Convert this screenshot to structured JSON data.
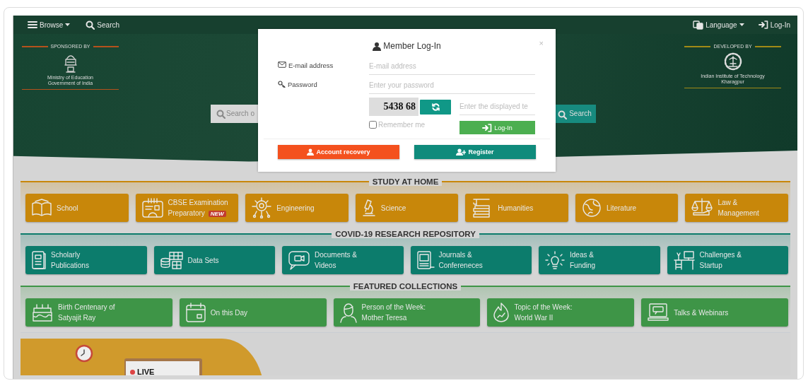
{
  "nav": {
    "browse": "Browse",
    "search": "Search",
    "language": "Language",
    "login": "Log-In"
  },
  "hero": {
    "sponsor": {
      "caption": "SPONSORED BY",
      "lines": "Ministry of Education\nGovernment of India"
    },
    "developer": {
      "caption": "DEVELOPED BY",
      "lines": "Indian Institute of Technology\nKharagpur"
    },
    "search": {
      "placeholder": "Search o",
      "button": "Search"
    }
  },
  "sections": [
    {
      "title": "STUDY AT HOME",
      "color": "#c8870a",
      "tiles": [
        {
          "label": "School"
        },
        {
          "label": "CBSE Examination\nPreparatory",
          "badge": "NEW"
        },
        {
          "label": "Engineering"
        },
        {
          "label": "Science"
        },
        {
          "label": "Humanities"
        },
        {
          "label": "Literature"
        },
        {
          "label": "Law &\nManagement"
        }
      ]
    },
    {
      "title": "COVID-19 RESEARCH REPOSITORY",
      "color": "#0c7c6c",
      "tiles": [
        {
          "label": "Scholarly\nPublications"
        },
        {
          "label": "Data Sets"
        },
        {
          "label": "Documents &\nVideos"
        },
        {
          "label": "Journals &\nConfereneces"
        },
        {
          "label": "Ideas &\nFunding"
        },
        {
          "label": "Challenges &\nStartup"
        }
      ]
    },
    {
      "title": "FEATURED COLLECTIONS",
      "color": "#3e9547",
      "tiles": [
        {
          "label": "Birth Centenary of\nSatyajit Ray"
        },
        {
          "label": "On this Day"
        },
        {
          "label": "Person of the Week:\nMother Teresa"
        },
        {
          "label": "Topic of the Week:\nWorld War II"
        },
        {
          "label": "Talks & Webinars"
        }
      ]
    }
  ],
  "banner": {
    "live": "LIVE"
  },
  "modal": {
    "title": "Member Log-In",
    "close": "×",
    "email": {
      "label": "E-mail address",
      "placeholder": "E-mail address"
    },
    "password": {
      "label": "Password",
      "placeholder": "Enter your password"
    },
    "captcha": {
      "code": "5438 68",
      "placeholder": "Enter the displayed te"
    },
    "remember": {
      "label": "Remember me",
      "checked": false
    },
    "login_button": "Log-In",
    "recovery_button": "Account recovery",
    "register_button": "Register"
  }
}
